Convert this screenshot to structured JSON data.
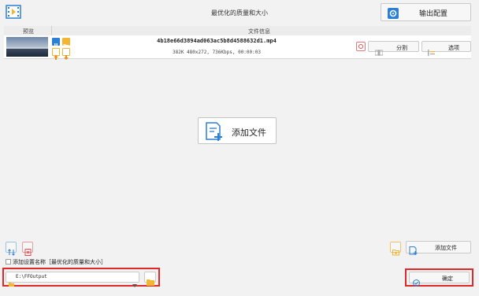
{
  "title": "最优化的质量和大小",
  "output_config_label": "输出配置",
  "table": {
    "col_preview": "预览",
    "col_file_info": "文件信息"
  },
  "file": {
    "name": "4b18e66d3894ad063ac5b8d4588632d1.mp4",
    "info": "382K 480x272, 736Kbps, 00:00:03",
    "split_label": "分割",
    "options_label": "选项"
  },
  "add_file_center_label": "添加文件",
  "add_file_small_label": "添加文件",
  "add_setting_name_label": "添加设置名称［最优化的质量和大小］",
  "output_path": "E:\\FFOutput",
  "ok_label": "确定",
  "colors": {
    "highlight": "#e02828",
    "accent_blue": "#2b7fd6",
    "folder_yellow": "#f2b632"
  }
}
